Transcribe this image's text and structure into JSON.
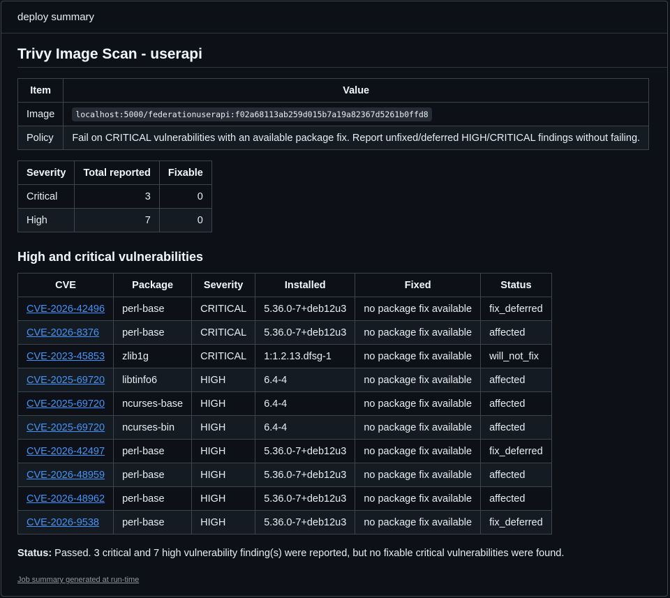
{
  "header": {
    "title": "deploy summary"
  },
  "page_title": "Trivy Image Scan - userapi",
  "info_table": {
    "headers": [
      "Item",
      "Value"
    ],
    "rows": [
      {
        "item": "Image",
        "value": "localhost:5000/federationuserapi:f02a68113ab259d015b7a19a82367d5261b0ffd8"
      },
      {
        "item": "Policy",
        "value": "Fail on CRITICAL vulnerabilities with an available package fix. Report unfixed/deferred HIGH/CRITICAL findings without failing."
      }
    ]
  },
  "severity_table": {
    "headers": [
      "Severity",
      "Total reported",
      "Fixable"
    ],
    "rows": [
      {
        "severity": "Critical",
        "total": "3",
        "fixable": "0"
      },
      {
        "severity": "High",
        "total": "7",
        "fixable": "0"
      }
    ]
  },
  "vuln_heading": "High and critical vulnerabilities",
  "vuln_table": {
    "headers": [
      "CVE",
      "Package",
      "Severity",
      "Installed",
      "Fixed",
      "Status"
    ],
    "rows": [
      {
        "cve": "CVE-2026-42496",
        "package": "perl-base",
        "severity": "CRITICAL",
        "installed": "5.36.0-7+deb12u3",
        "fixed": "no package fix available",
        "status": "fix_deferred"
      },
      {
        "cve": "CVE-2026-8376",
        "package": "perl-base",
        "severity": "CRITICAL",
        "installed": "5.36.0-7+deb12u3",
        "fixed": "no package fix available",
        "status": "affected"
      },
      {
        "cve": "CVE-2023-45853",
        "package": "zlib1g",
        "severity": "CRITICAL",
        "installed": "1:1.2.13.dfsg-1",
        "fixed": "no package fix available",
        "status": "will_not_fix"
      },
      {
        "cve": "CVE-2025-69720",
        "package": "libtinfo6",
        "severity": "HIGH",
        "installed": "6.4-4",
        "fixed": "no package fix available",
        "status": "affected"
      },
      {
        "cve": "CVE-2025-69720",
        "package": "ncurses-base",
        "severity": "HIGH",
        "installed": "6.4-4",
        "fixed": "no package fix available",
        "status": "affected"
      },
      {
        "cve": "CVE-2025-69720",
        "package": "ncurses-bin",
        "severity": "HIGH",
        "installed": "6.4-4",
        "fixed": "no package fix available",
        "status": "affected"
      },
      {
        "cve": "CVE-2026-42497",
        "package": "perl-base",
        "severity": "HIGH",
        "installed": "5.36.0-7+deb12u3",
        "fixed": "no package fix available",
        "status": "fix_deferred"
      },
      {
        "cve": "CVE-2026-48959",
        "package": "perl-base",
        "severity": "HIGH",
        "installed": "5.36.0-7+deb12u3",
        "fixed": "no package fix available",
        "status": "affected"
      },
      {
        "cve": "CVE-2026-48962",
        "package": "perl-base",
        "severity": "HIGH",
        "installed": "5.36.0-7+deb12u3",
        "fixed": "no package fix available",
        "status": "affected"
      },
      {
        "cve": "CVE-2026-9538",
        "package": "perl-base",
        "severity": "HIGH",
        "installed": "5.36.0-7+deb12u3",
        "fixed": "no package fix available",
        "status": "fix_deferred"
      }
    ]
  },
  "status": {
    "label": "Status:",
    "text": " Passed. 3 critical and 7 high vulnerability finding(s) were reported, but no fixable critical vulnerabilities were found."
  },
  "footer": "Job summary generated at run-time",
  "colors": {
    "background": "#0d1117",
    "link": "#4493f8",
    "border": "#3d444d"
  }
}
